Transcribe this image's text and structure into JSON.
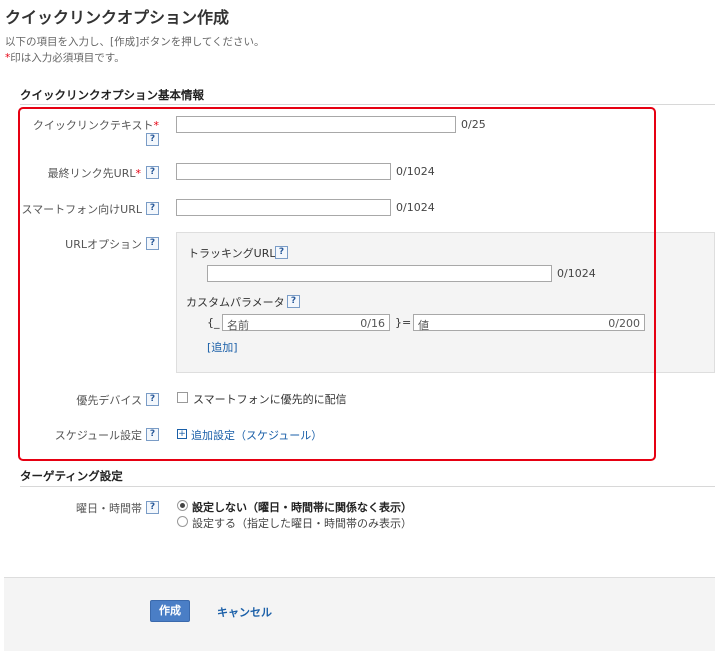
{
  "page": {
    "title": "クイックリンクオプション作成",
    "description": "以下の項目を入力し、[作成]ボタンを押してください。",
    "required_mark": "*",
    "required_note": "印は入力必須項目です。"
  },
  "basic_section": {
    "title": "クイックリンクオプション基本情報",
    "link_text": {
      "label": "クイックリンクテキスト",
      "value": "",
      "counter": "0/25"
    },
    "final_url": {
      "label": "最終リンク先URL",
      "value": "",
      "counter": "0/1024"
    },
    "mobile_url": {
      "label": "スマートフォン向けURL",
      "value": "",
      "counter": "0/1024"
    },
    "url_options": {
      "label": "URLオプション",
      "tracking_label": "トラッキングURL",
      "tracking_value": "",
      "tracking_counter": "0/1024",
      "custom_param_label": "カスタムパラメータ",
      "brace_open": "{_",
      "name_placeholder": "名前",
      "name_counter": "0/16",
      "equals": "}=",
      "value_placeholder": "値",
      "value_counter": "0/200",
      "add_link": "[追加]"
    },
    "device": {
      "label": "優先デバイス",
      "checkbox_label": "スマートフォンに優先的に配信"
    },
    "schedule": {
      "label": "スケジュール設定",
      "add_link": "追加設定（スケジュール）"
    }
  },
  "targeting_section": {
    "title": "ターゲティング設定",
    "day_time": {
      "label": "曜日・時間帯",
      "option_none": "設定しない（曜日・時間帯に関係なく表示）",
      "option_set": "設定する（指定した曜日・時間帯のみ表示）"
    }
  },
  "help_label": "?",
  "footer": {
    "create_label": "作成",
    "cancel_label": "キャンセル"
  },
  "colors": {
    "required": "#e60012",
    "link": "#1a5fa8",
    "primary_button": "#4a7ec6",
    "highlight_border": "#e60012"
  }
}
